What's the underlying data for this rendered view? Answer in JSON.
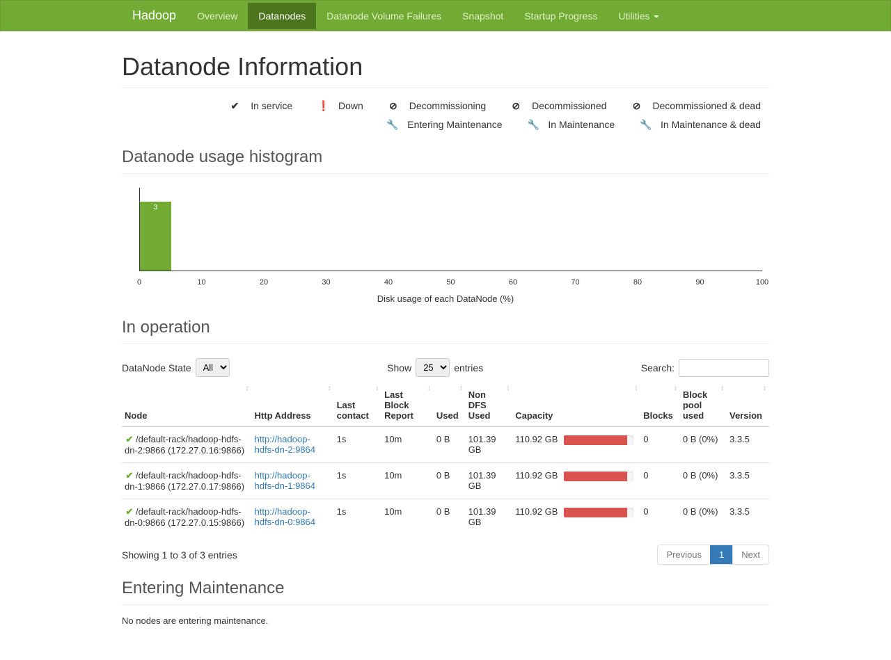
{
  "nav": {
    "brand": "Hadoop",
    "items": [
      {
        "label": "Overview",
        "active": false
      },
      {
        "label": "Datanodes",
        "active": true
      },
      {
        "label": "Datanode Volume Failures",
        "active": false
      },
      {
        "label": "Snapshot",
        "active": false
      },
      {
        "label": "Startup Progress",
        "active": false
      },
      {
        "label": "Utilities",
        "active": false,
        "dropdown": true
      }
    ]
  },
  "page_title": "Datanode Information",
  "legend": {
    "items": [
      {
        "icon": "check",
        "color": "green",
        "label": "In service"
      },
      {
        "icon": "exclaim",
        "color": "red",
        "label": "Down"
      },
      {
        "icon": "ban",
        "color": "green",
        "label": "Decommissioning"
      },
      {
        "icon": "ban",
        "color": "orange",
        "label": "Decommissioned"
      },
      {
        "icon": "ban",
        "color": "red",
        "label": "Decommissioned & dead"
      },
      {
        "icon": "wrench",
        "color": "green",
        "label": "Entering Maintenance"
      },
      {
        "icon": "wrench",
        "color": "orange",
        "label": "In Maintenance"
      },
      {
        "icon": "wrench",
        "color": "darkred",
        "label": "In Maintenance & dead"
      }
    ]
  },
  "histogram_heading": "Datanode usage histogram",
  "chart_data": {
    "type": "bar",
    "title": "",
    "xlabel": "Disk usage of each DataNode (%)",
    "ylabel": "",
    "x_ticks": [
      0,
      10,
      20,
      30,
      40,
      50,
      60,
      70,
      80,
      90,
      100
    ],
    "bars": [
      {
        "bin_start": 0,
        "bin_end": 5,
        "value": 3
      }
    ],
    "ylim": [
      0,
      3
    ]
  },
  "in_operation": {
    "heading": "In operation",
    "state_label": "DataNode State",
    "state_options": [
      "All"
    ],
    "state_selected": "All",
    "show_label_pre": "Show",
    "show_label_post": "entries",
    "show_options": [
      "25"
    ],
    "show_selected": "25",
    "search_label": "Search:",
    "columns": [
      "Node",
      "Http Address",
      "Last contact",
      "Last Block Report",
      "Used",
      "Non DFS Used",
      "Capacity",
      "Blocks",
      "Block pool used",
      "Version"
    ],
    "rows": [
      {
        "status_icon": "check",
        "node": "/default-rack/hadoop-hdfs-dn-2:9866 (172.27.0.16:9866)",
        "http_address": "http://hadoop-hdfs-dn-2:9864",
        "last_contact": "1s",
        "last_block_report": "10m",
        "used": "0 B",
        "non_dfs_used": "101.39 GB",
        "capacity_text": "110.92 GB",
        "capacity_pct": 91,
        "blocks": "0",
        "block_pool_used": "0 B (0%)",
        "version": "3.3.5"
      },
      {
        "status_icon": "check",
        "node": "/default-rack/hadoop-hdfs-dn-1:9866 (172.27.0.17:9866)",
        "http_address": "http://hadoop-hdfs-dn-1:9864",
        "last_contact": "1s",
        "last_block_report": "10m",
        "used": "0 B",
        "non_dfs_used": "101.39 GB",
        "capacity_text": "110.92 GB",
        "capacity_pct": 91,
        "blocks": "0",
        "block_pool_used": "0 B (0%)",
        "version": "3.3.5"
      },
      {
        "status_icon": "check",
        "node": "/default-rack/hadoop-hdfs-dn-0:9866 (172.27.0.15:9866)",
        "http_address": "http://hadoop-hdfs-dn-0:9864",
        "last_contact": "1s",
        "last_block_report": "10m",
        "used": "0 B",
        "non_dfs_used": "101.39 GB",
        "capacity_text": "110.92 GB",
        "capacity_pct": 91,
        "blocks": "0",
        "block_pool_used": "0 B (0%)",
        "version": "3.3.5"
      }
    ],
    "showing_text": "Showing 1 to 3 of 3 entries",
    "pager": {
      "previous": "Previous",
      "pages": [
        "1"
      ],
      "next": "Next",
      "current": "1"
    }
  },
  "entering_maintenance": {
    "heading": "Entering Maintenance",
    "note": "No nodes are entering maintenance."
  },
  "icon_glyphs": {
    "check": "✔",
    "exclaim": "❗",
    "ban": "⊘",
    "wrench": "🔧"
  }
}
